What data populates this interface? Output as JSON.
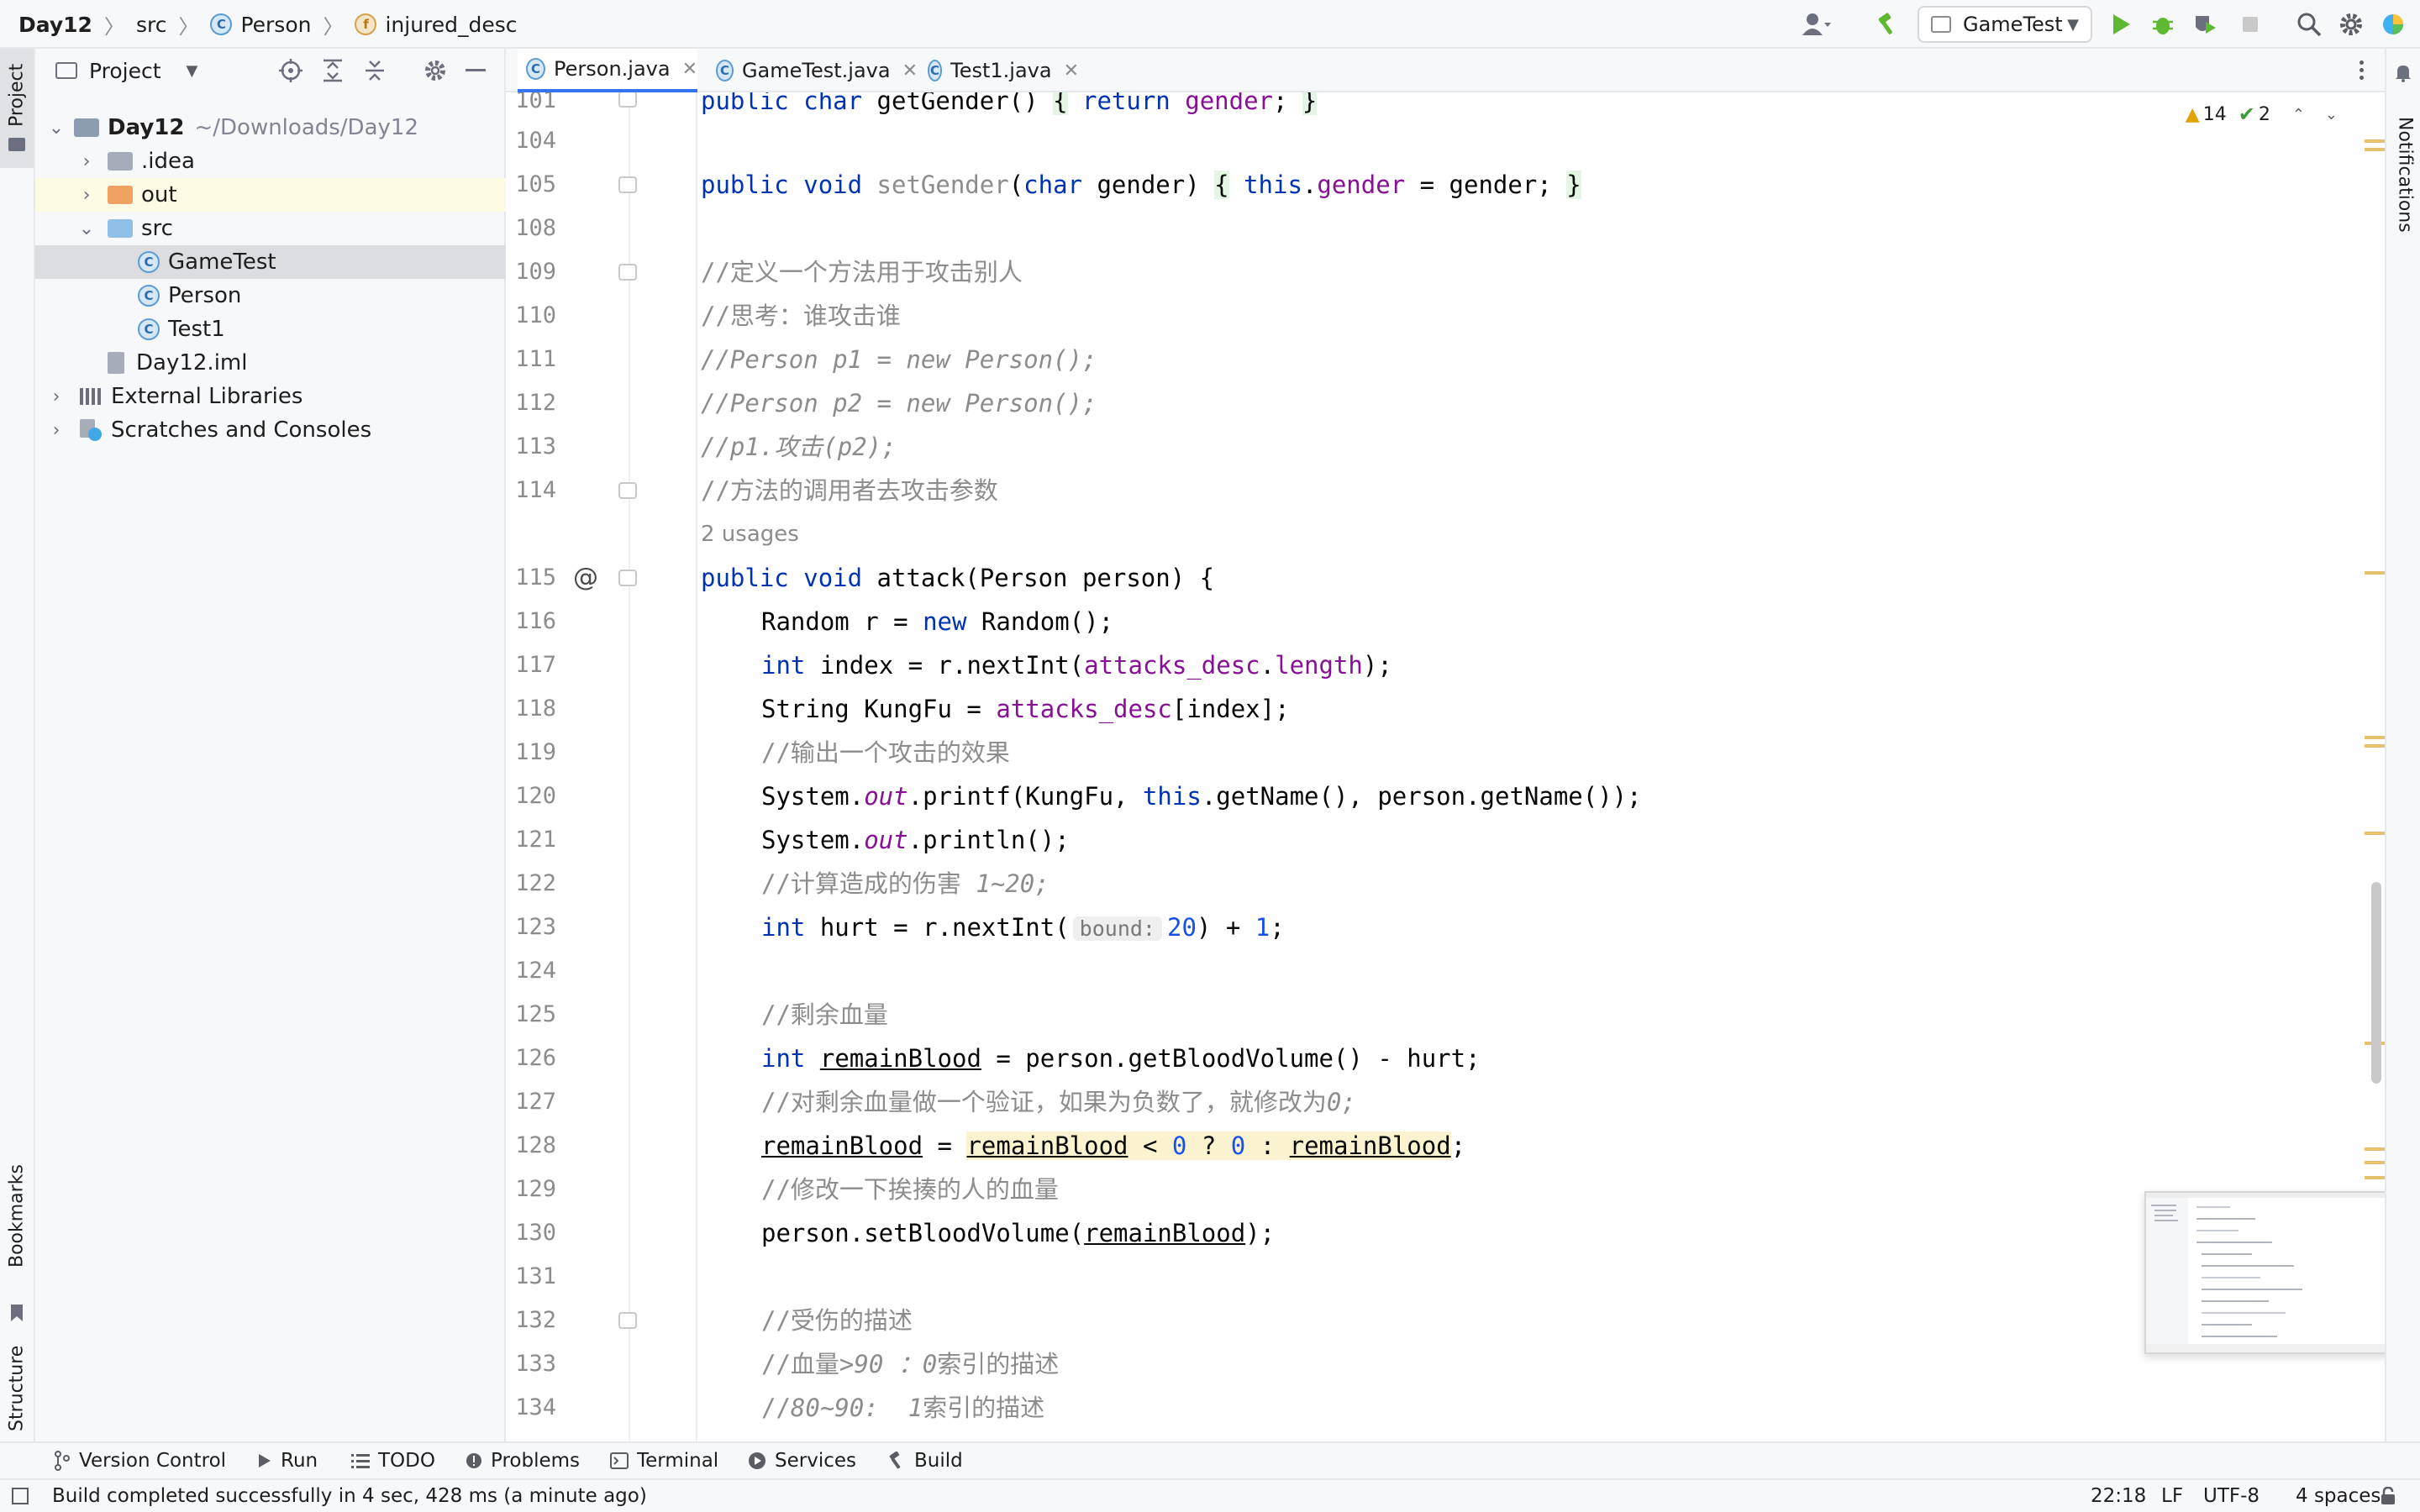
{
  "breadcrumb": {
    "project": "Day12",
    "folder": "src",
    "class": "Person",
    "field": "injured_desc"
  },
  "run_config": {
    "label": "GameTest"
  },
  "project_panel": {
    "title": "Project",
    "tree": [
      {
        "label": "Day12",
        "path": "~/Downloads/Day12",
        "icon": "module-folder-icon"
      },
      {
        "label": ".idea",
        "icon": "folder-icon"
      },
      {
        "label": "out",
        "icon": "excluded-folder-icon"
      },
      {
        "label": "src",
        "icon": "source-folder-icon"
      },
      {
        "label": "GameTest",
        "icon": "java-class-run-icon"
      },
      {
        "label": "Person",
        "icon": "java-class-icon"
      },
      {
        "label": "Test1",
        "icon": "java-class-icon"
      },
      {
        "label": "Day12.iml",
        "icon": "iml-file-icon"
      },
      {
        "label": "External Libraries",
        "icon": "library-icon"
      },
      {
        "label": "Scratches and Consoles",
        "icon": "scratch-icon"
      }
    ]
  },
  "tabs": [
    {
      "label": "Person.java",
      "active": true
    },
    {
      "label": "GameTest.java",
      "active": false
    },
    {
      "label": "Test1.java",
      "active": false
    }
  ],
  "inspections": {
    "warnings": "14",
    "ok": "2"
  },
  "editor": {
    "usages": "2 usages",
    "param_hint": "bound:",
    "line_numbers": [
      "101",
      "104",
      "105",
      "108",
      "109",
      "110",
      "111",
      "112",
      "113",
      "114",
      "115",
      "116",
      "117",
      "118",
      "119",
      "120",
      "121",
      "122",
      "123",
      "124",
      "125",
      "126",
      "127",
      "128",
      "129",
      "130",
      "131",
      "132",
      "133",
      "134"
    ],
    "comments": {
      "c109": "//定义一个方法用于攻击别人",
      "c110": "//思考：谁攻击谁",
      "c111": "//Person p1 = new Person();",
      "c112": "//Person p2 = new Person();",
      "c113": "//p1.攻击(p2);",
      "c114": "//方法的调用者去攻击参数",
      "c119": "//输出一个攻击的效果",
      "c122a": "//计算造成的伤害 ",
      "c122b": "1~20;",
      "c125": "//剩余血量",
      "c127a": "//对剩余血量做一个验证，如果为负数了，就修改为",
      "c127b": "0;",
      "c129": "//修改一下挨揍的人的血量",
      "c132": "//受伤的描述",
      "c133a": "//血量",
      "c133b": ">90 ：0",
      "c133c": "索引的描述",
      "c134a": "//",
      "c134b": "80~90:  1",
      "c134c": "索引的描述"
    }
  },
  "tool_windows": [
    "Version Control",
    "Run",
    "TODO",
    "Problems",
    "Terminal",
    "Services",
    "Build"
  ],
  "side_tabs": {
    "project": "Project",
    "bookmarks": "Bookmarks",
    "structure": "Structure",
    "notifications": "Notifications"
  },
  "status_bar": {
    "message": "Build completed successfully in 4 sec, 428 ms (a minute ago)",
    "position": "22:18",
    "line_sep": "LF",
    "encoding": "UTF-8",
    "indent": "4 spaces"
  }
}
